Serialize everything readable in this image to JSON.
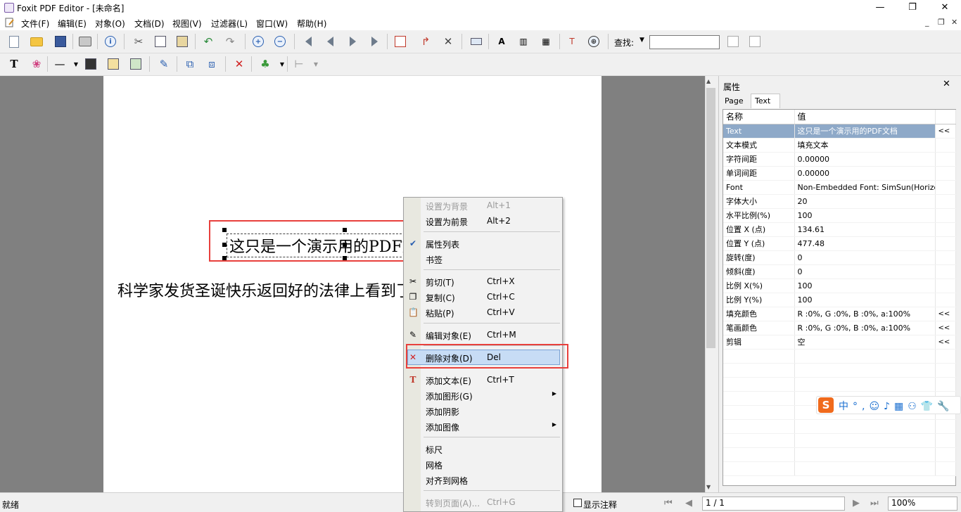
{
  "window": {
    "title": "Foxit PDF Editor - [未命名]",
    "minimize": "—",
    "maximize": "❐",
    "close": "✕"
  },
  "menu": {
    "items": [
      "文件(F)",
      "编辑(E)",
      "对象(O)",
      "文档(D)",
      "视图(V)",
      "过滤器(L)",
      "窗口(W)",
      "帮助(H)"
    ],
    "mdi_buttons": [
      "_",
      "❐",
      "✕"
    ]
  },
  "toolbar": {
    "find_label": "查找:",
    "find_value": ""
  },
  "document": {
    "line1": "这只是一个演示用的PDF文档",
    "line2": "科学家发货圣诞快乐返回好的法律上看到了各种经费"
  },
  "properties": {
    "title": "属性",
    "close": "✕",
    "tabs": [
      "Page",
      "Text"
    ],
    "headers": [
      "名称",
      "值"
    ],
    "rows": [
      {
        "name": "Text",
        "value": "这只是一个演示用的PDF文档",
        "btn": "<<"
      },
      {
        "name": "文本模式",
        "value": "填充文本",
        "btn": ""
      },
      {
        "name": "字符间距",
        "value": "0.00000",
        "btn": ""
      },
      {
        "name": "单词间距",
        "value": "0.00000",
        "btn": ""
      },
      {
        "name": "Font",
        "value": "Non-Embedded Font: SimSun(Horizontal)",
        "btn": ""
      },
      {
        "name": "字体大小",
        "value": "20",
        "btn": ""
      },
      {
        "name": "水平比例(%)",
        "value": "100",
        "btn": ""
      },
      {
        "name": "位置 X (点)",
        "value": "134.61",
        "btn": ""
      },
      {
        "name": "位置 Y (点)",
        "value": "477.48",
        "btn": ""
      },
      {
        "name": "旋转(度)",
        "value": "0",
        "btn": ""
      },
      {
        "name": "倾斜(度)",
        "value": "0",
        "btn": ""
      },
      {
        "name": "比例 X(%)",
        "value": "100",
        "btn": ""
      },
      {
        "name": "比例 Y(%)",
        "value": "100",
        "btn": ""
      },
      {
        "name": "填充颜色",
        "value": "R :0%, G :0%, B :0%, a:100%",
        "btn": "<<"
      },
      {
        "name": "笔画颜色",
        "value": "R :0%, G :0%, B :0%, a:100%",
        "btn": "<<"
      },
      {
        "name": "剪辑",
        "value": "空",
        "btn": "<<"
      }
    ]
  },
  "ime": {
    "logo": "S",
    "items": "中°,☺♪▦⚇👕🔧"
  },
  "context_menu": {
    "items": [
      {
        "label": "设置为背景",
        "shortcut": "Alt+1",
        "disabled": true,
        "icon": ""
      },
      {
        "label": "设置为前景",
        "shortcut": "Alt+2",
        "disabled": false,
        "icon": ""
      },
      {
        "label": "属性列表",
        "shortcut": "",
        "disabled": false,
        "icon": "✔"
      },
      {
        "label": "书签",
        "shortcut": "",
        "disabled": false,
        "icon": ""
      },
      {
        "label": "剪切(T)",
        "shortcut": "Ctrl+X",
        "disabled": false,
        "icon": "✂"
      },
      {
        "label": "复制(C)",
        "shortcut": "Ctrl+C",
        "disabled": false,
        "icon": "❐"
      },
      {
        "label": "粘贴(P)",
        "shortcut": "Ctrl+V",
        "disabled": false,
        "icon": "📋"
      },
      {
        "label": "编辑对象(E)",
        "shortcut": "Ctrl+M",
        "disabled": false,
        "icon": "✎"
      },
      {
        "label": "删除对象(D)",
        "shortcut": "Del",
        "disabled": false,
        "icon": "✕"
      },
      {
        "label": "添加文本(E)",
        "shortcut": "Ctrl+T",
        "disabled": false,
        "icon": "T"
      },
      {
        "label": "添加图形(G)",
        "shortcut": "",
        "disabled": false,
        "icon": "",
        "submenu": true
      },
      {
        "label": "添加阴影",
        "shortcut": "",
        "disabled": false,
        "icon": ""
      },
      {
        "label": "添加图像",
        "shortcut": "",
        "disabled": false,
        "icon": "",
        "submenu": true
      },
      {
        "label": "标尺",
        "shortcut": "",
        "disabled": false,
        "icon": ""
      },
      {
        "label": "网格",
        "shortcut": "",
        "disabled": false,
        "icon": ""
      },
      {
        "label": "对齐到网格",
        "shortcut": "",
        "disabled": false,
        "icon": ""
      },
      {
        "label": "转到页面(A)...",
        "shortcut": "Ctrl+G",
        "disabled": true,
        "icon": ""
      }
    ]
  },
  "status": {
    "text": "就绪",
    "show_notes": "显示注释",
    "page": "1 / 1",
    "zoom": "100%"
  },
  "colors": {
    "highlight_red": "#e8403c",
    "selection_blue": "#8ea9c8",
    "menu_hover": "#c7dcf5"
  }
}
